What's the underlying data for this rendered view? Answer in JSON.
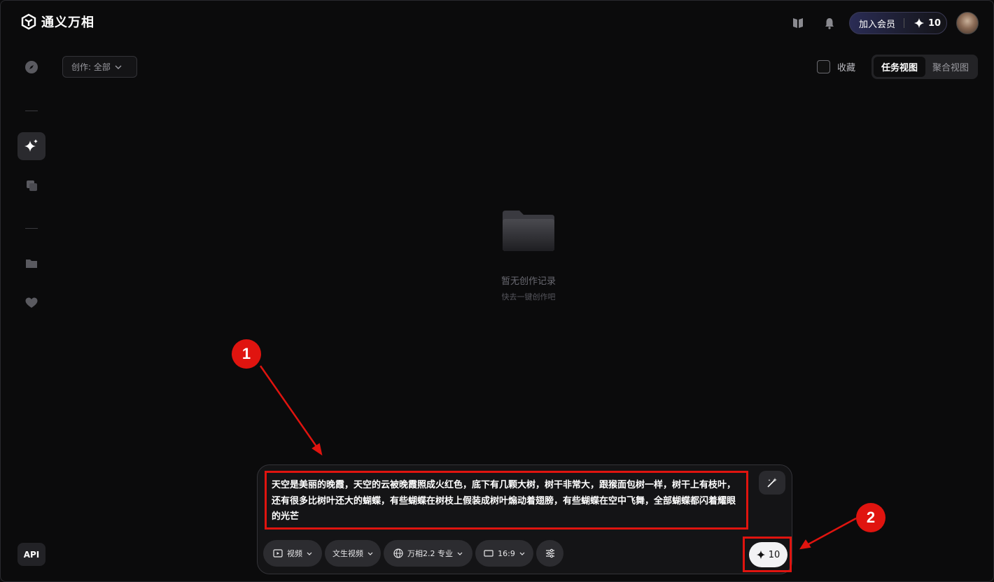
{
  "app": {
    "logo_text": "通义万相"
  },
  "header": {
    "member_label": "加入会员",
    "credits": "10"
  },
  "sidebar": {
    "items": [
      {
        "name": "explore",
        "icon": "compass-icon"
      },
      {
        "name": "create",
        "icon": "sparkle-icon",
        "active": true
      },
      {
        "name": "gallery",
        "icon": "layers-icon"
      },
      {
        "name": "folder",
        "icon": "folder-icon"
      },
      {
        "name": "likes",
        "icon": "heart-icon"
      }
    ],
    "api_label": "API"
  },
  "filters": {
    "create_filter_label": "创作: 全部",
    "favorite_label": "收藏",
    "views": [
      {
        "label": "任务视图",
        "active": true
      },
      {
        "label": "聚合视图",
        "active": false
      }
    ]
  },
  "empty_state": {
    "title": "暂无创作记录",
    "subtitle": "快去一键创作吧"
  },
  "composer": {
    "prompt": "天空是美丽的晚霞，天空的云被晚霞照成火红色，底下有几颗大树，树干非常大，跟猴面包树一样，树干上有枝叶，还有很多比树叶还大的蝴蝶，有些蝴蝶在树枝上假装成树叶煽动着翅膀，有些蝴蝶在空中飞舞，全部蝴蝶都闪着耀眼的光芒",
    "options": {
      "media": "视频",
      "mode": "文生视频",
      "model": "万相2.2 专业",
      "ratio": "16:9"
    },
    "generate_credits": "10"
  },
  "annotations": {
    "badge_1": "1",
    "badge_2": "2",
    "highlight_color": "#e0140f"
  }
}
